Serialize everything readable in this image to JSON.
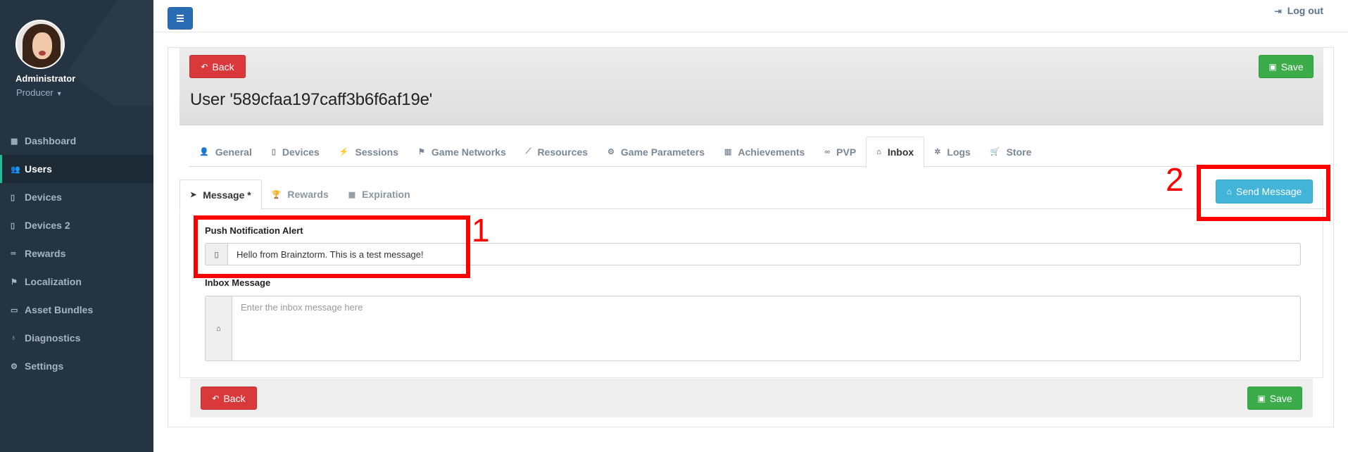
{
  "sidebar": {
    "profile": {
      "name": "Administrator",
      "role": "Producer"
    },
    "items": [
      {
        "label": "Dashboard",
        "icon": "dashboard-icon",
        "glyph": "▦"
      },
      {
        "label": "Users",
        "icon": "users-icon",
        "glyph": "👥"
      },
      {
        "label": "Devices",
        "icon": "mobile-icon",
        "glyph": "▯"
      },
      {
        "label": "Devices 2",
        "icon": "mobile-icon",
        "glyph": "▯"
      },
      {
        "label": "Rewards",
        "icon": "link-icon",
        "glyph": "∞"
      },
      {
        "label": "Localization",
        "icon": "flag-icon",
        "glyph": "⚑"
      },
      {
        "label": "Asset Bundles",
        "icon": "folder-open-icon",
        "glyph": "▭"
      },
      {
        "label": "Diagnostics",
        "icon": "stethoscope-icon",
        "glyph": "♁"
      },
      {
        "label": "Settings",
        "icon": "cogs-icon",
        "glyph": "⚙"
      }
    ],
    "active_index": 1
  },
  "topbar": {
    "logout_label": "Log out"
  },
  "header": {
    "back_label": "Back",
    "save_label": "Save",
    "title": "User '589cfaa197caff3b6f6af19e'"
  },
  "tabs": [
    {
      "label": "General",
      "glyph": "👤"
    },
    {
      "label": "Devices",
      "glyph": "▯"
    },
    {
      "label": "Sessions",
      "glyph": "⚡"
    },
    {
      "label": "Game Networks",
      "glyph": "⚑"
    },
    {
      "label": "Resources",
      "glyph": "⟋"
    },
    {
      "label": "Game Parameters",
      "glyph": "⚙"
    },
    {
      "label": "Achievements",
      "glyph": "▥"
    },
    {
      "label": "PVP",
      "glyph": "∞"
    },
    {
      "label": "Inbox",
      "glyph": "⌂"
    },
    {
      "label": "Logs",
      "glyph": "✲"
    },
    {
      "label": "Store",
      "glyph": "🛒"
    }
  ],
  "active_tab": "Inbox",
  "subtabs": [
    {
      "label": "Message *",
      "glyph": "➤"
    },
    {
      "label": "Rewards",
      "glyph": "🏆"
    },
    {
      "label": "Expiration",
      "glyph": "▦"
    }
  ],
  "active_subtab": "Message *",
  "send_message_label": "Send Message",
  "push_alert": {
    "label": "Push Notification Alert",
    "value": "Hello from Brainztorm. This is a test message!"
  },
  "inbox_message": {
    "label": "Inbox Message",
    "placeholder": "Enter the inbox message here"
  },
  "footer": {
    "back_label": "Back",
    "save_label": "Save"
  },
  "annotations": [
    {
      "number": "1"
    },
    {
      "number": "2"
    }
  ],
  "colors": {
    "sidebar_bg": "#243442",
    "accent_green": "#26b99a",
    "back_button": "#d9393b",
    "save_button": "#3cab4a",
    "send_button": "#41b4d8",
    "menu_button": "#2a6db5",
    "annotation": "#ff0000"
  }
}
